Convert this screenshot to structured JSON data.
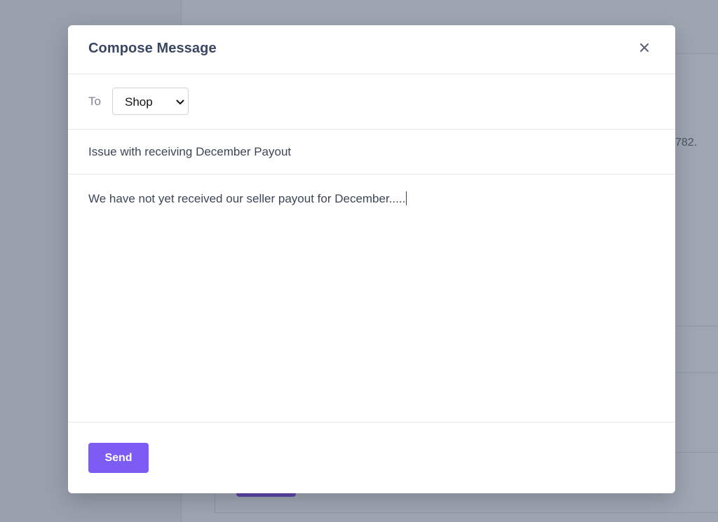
{
  "background": {
    "partial_text": "782."
  },
  "modal": {
    "title": "Compose Message",
    "close_icon": "close-icon",
    "to_label": "To",
    "to_select": {
      "value": "Shop",
      "icon": "chevron-down-icon"
    },
    "subject_value": "Issue with receiving December Payout",
    "body_value": "We have not yet received our seller payout for December.....",
    "send_label": "Send"
  },
  "colors": {
    "accent": "#7c5cf3",
    "title_text": "#3a4762",
    "overlay": "#9aa2ae"
  }
}
